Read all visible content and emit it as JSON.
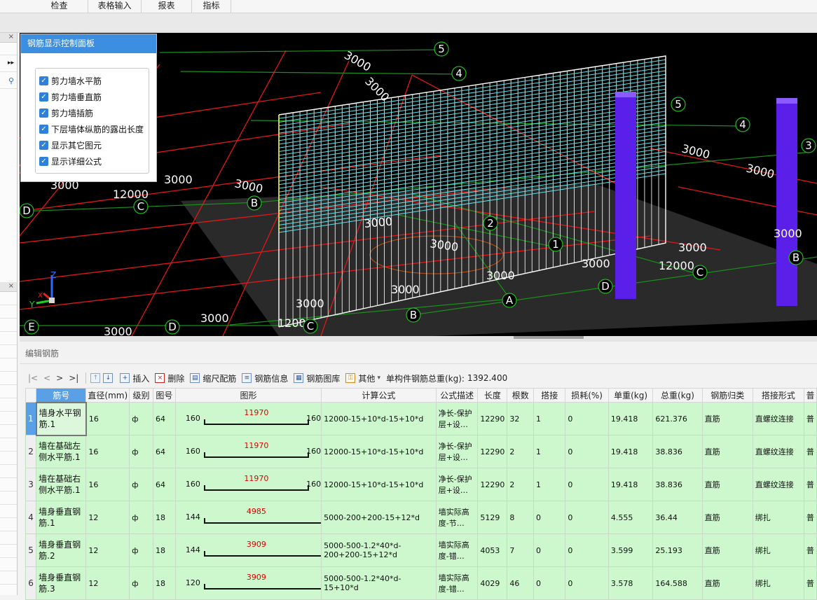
{
  "menu": {
    "items": [
      "检查",
      "表格输入",
      "报表",
      "指标"
    ]
  },
  "control_panel": {
    "title": "钢筋显示控制面板",
    "options": [
      {
        "label": "剪力墙水平筋",
        "checked": true
      },
      {
        "label": "剪力墙垂直筋",
        "checked": true
      },
      {
        "label": "剪力墙插筋",
        "checked": true
      },
      {
        "label": "下层墙体纵筋的露出长度",
        "checked": true
      },
      {
        "label": "显示其它图元",
        "checked": true
      },
      {
        "label": "显示详细公式",
        "checked": true
      }
    ]
  },
  "viewport": {
    "labels_3000": [
      "3000",
      "3000",
      "3000",
      "3000",
      "3000",
      "3000",
      "3000",
      "3000",
      "3000",
      "3000",
      "3000",
      "3000",
      "3000",
      "3000",
      "3000",
      "3000",
      "3000"
    ],
    "labels_12000": [
      "12000",
      "12000",
      "12000"
    ],
    "axis_circles": [
      "5",
      "4",
      "5",
      "4",
      "3",
      "D",
      "C",
      "B",
      "2",
      "1",
      "D",
      "C",
      "B",
      "A",
      "B",
      "E",
      "D",
      "C"
    ],
    "triad": {
      "x": "X",
      "y": "Y",
      "z": "Z"
    }
  },
  "edit_panel": {
    "title": "编辑钢筋",
    "toolbar": {
      "nav": [
        "|<",
        "<",
        ">",
        ">|"
      ],
      "insert": "插入",
      "delete": "删除",
      "scale_config": "缩尺配筋",
      "rebar_info": "钢筋信息",
      "rebar_library": "钢筋图库",
      "other": "其他",
      "total_label": "单构件钢筋总重(kg):",
      "total_value": "1392.400"
    },
    "columns": [
      "筋号",
      "直径(mm)",
      "级别",
      "图号",
      "图形",
      "计算公式",
      "公式描述",
      "长度",
      "根数",
      "搭接",
      "损耗(%)",
      "单重(kg)",
      "总重(kg)",
      "钢筋归类",
      "搭接形式",
      "普"
    ],
    "rows": [
      {
        "num": "1",
        "name": "墙身水平钢筋.1",
        "dia": "16",
        "grade": "ф",
        "fig": "64",
        "shape_left": "160",
        "shape_mid": "11970",
        "shape_right": "160",
        "formula": "12000-15+10*d-15+10*d",
        "desc": "净长-保护层+设…",
        "length": "12290",
        "count": "32",
        "lap": "1",
        "loss": "0",
        "unit_wt": "19.418",
        "total_wt": "621.376",
        "category": "直筋",
        "lap_form": "直螺纹连接",
        "extra": "普"
      },
      {
        "num": "2",
        "name": "墙在基础左侧水平筋.1",
        "dia": "16",
        "grade": "ф",
        "fig": "64",
        "shape_left": "160",
        "shape_mid": "11970",
        "shape_right": "160",
        "formula": "12000-15+10*d-15+10*d",
        "desc": "净长-保护层+设…",
        "length": "12290",
        "count": "2",
        "lap": "1",
        "loss": "0",
        "unit_wt": "19.418",
        "total_wt": "38.836",
        "category": "直筋",
        "lap_form": "直螺纹连接",
        "extra": "普"
      },
      {
        "num": "3",
        "name": "墙在基础右侧水平筋.1",
        "dia": "16",
        "grade": "ф",
        "fig": "64",
        "shape_left": "160",
        "shape_mid": "11970",
        "shape_right": "160",
        "formula": "12000-15+10*d-15+10*d",
        "desc": "净长-保护层+设…",
        "length": "12290",
        "count": "2",
        "lap": "1",
        "loss": "0",
        "unit_wt": "19.418",
        "total_wt": "38.836",
        "category": "直筋",
        "lap_form": "直螺纹连接",
        "extra": "普"
      },
      {
        "num": "4",
        "name": "墙身垂直钢筋.1",
        "dia": "12",
        "grade": "ф",
        "fig": "18",
        "shape_left": "144",
        "shape_mid": "4985",
        "shape_right": "",
        "formula": "5000-200+200-15+12*d",
        "desc": "墙实际高度-节…",
        "length": "5129",
        "count": "8",
        "lap": "0",
        "loss": "0",
        "unit_wt": "4.555",
        "total_wt": "36.44",
        "category": "直筋",
        "lap_form": "绑扎",
        "extra": "普"
      },
      {
        "num": "5",
        "name": "墙身垂直钢筋.2",
        "dia": "12",
        "grade": "ф",
        "fig": "18",
        "shape_left": "144",
        "shape_mid": "3909",
        "shape_right": "",
        "formula": "5000-500-1.2*40*d-200+200-15+12*d",
        "desc": "墙实际高度-错…",
        "length": "4053",
        "count": "7",
        "lap": "0",
        "loss": "0",
        "unit_wt": "3.599",
        "total_wt": "25.193",
        "category": "直筋",
        "lap_form": "绑扎",
        "extra": "普"
      },
      {
        "num": "6",
        "name": "墙身垂直钢筋.3",
        "dia": "12",
        "grade": "ф",
        "fig": "18",
        "shape_left": "120",
        "shape_mid": "3909",
        "shape_right": "",
        "formula": "5000-500-1.2*40*d-15+10*d",
        "desc": "墙实际高度-错…",
        "length": "4029",
        "count": "46",
        "lap": "0",
        "loss": "0",
        "unit_wt": "3.578",
        "total_wt": "164.588",
        "category": "直筋",
        "lap_form": "绑扎",
        "extra": "普"
      }
    ]
  },
  "colors": {
    "accent": "#3c8fe0",
    "row_bg": "#cdf7cd",
    "rebar_cyan": "#58e6f0",
    "column_purple": "#5a1fe8",
    "grid_red": "#e01818",
    "grid_green": "#1a8f1a"
  }
}
